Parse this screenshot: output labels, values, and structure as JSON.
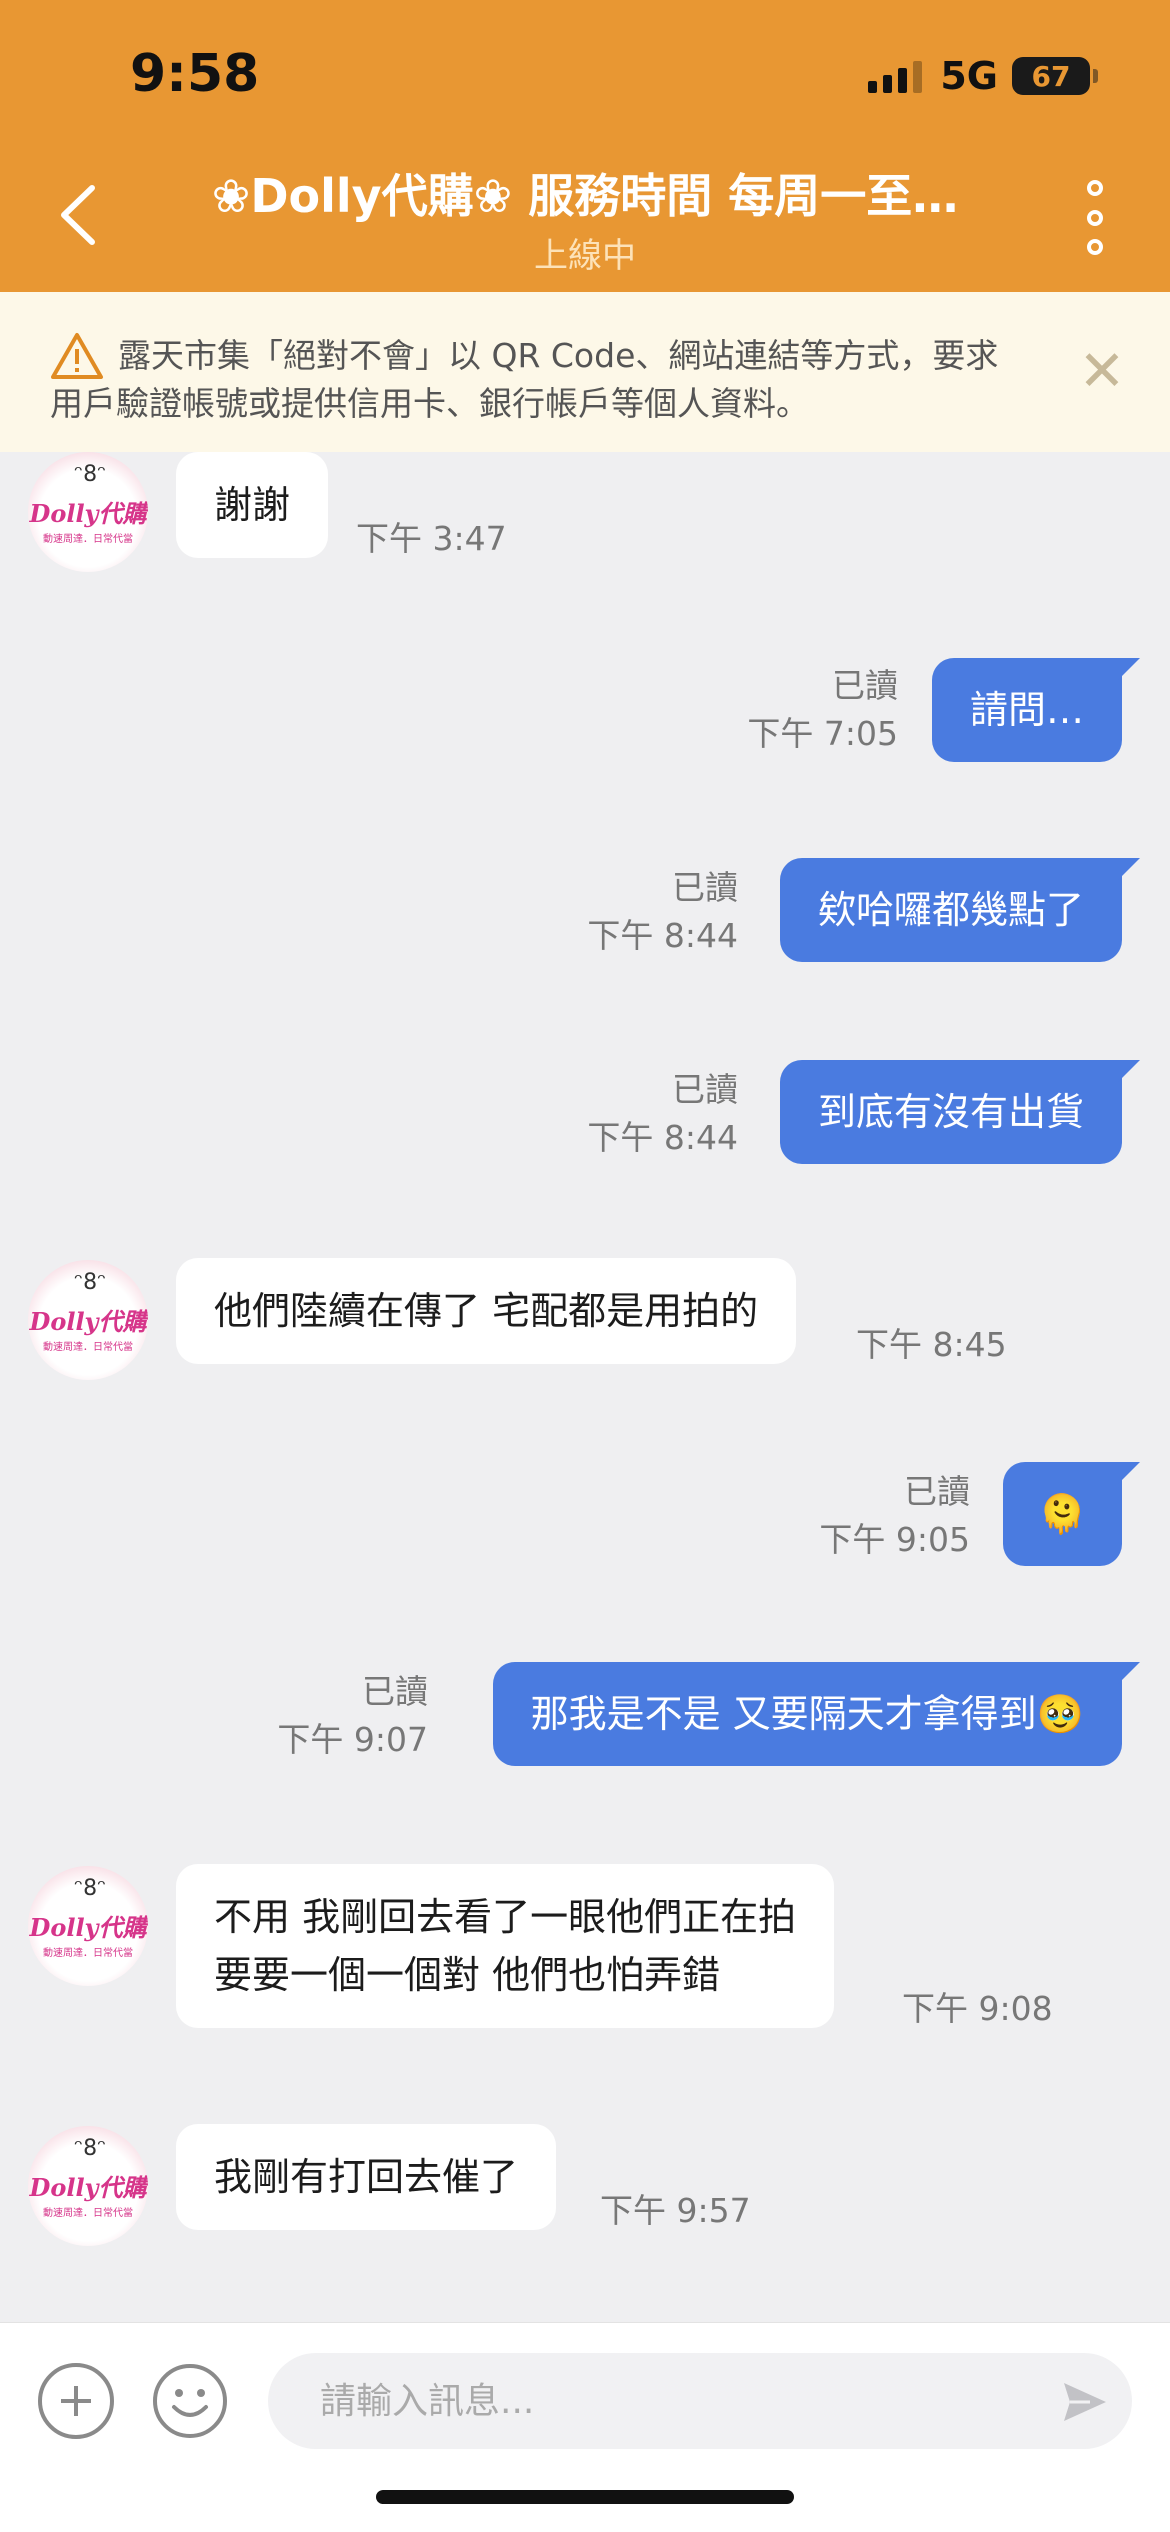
{
  "status_bar": {
    "time": "9:58",
    "network": "5G",
    "battery": "67"
  },
  "header": {
    "title": "❀Dolly代購❀ 服務時間 每周一至…",
    "subtitle": "上線中"
  },
  "warning": {
    "text": "露天市集「絕對不會」以 QR Code、網站連結等方式，要求用戶驗證帳號或提供信用卡、銀行帳戶等個人資料。",
    "close_symbol": "✕"
  },
  "avatar": {
    "logo_text": "Dolly代購",
    "sub_text": "動速周達．日常代當"
  },
  "messages": [
    {
      "side": "in",
      "text": "謝謝",
      "time": "下午 3:47"
    },
    {
      "side": "out",
      "text": "請問…",
      "read": "已讀",
      "time": "下午 7:05"
    },
    {
      "side": "out",
      "text": "欸哈囉都幾點了",
      "read": "已讀",
      "time": "下午 8:44"
    },
    {
      "side": "out",
      "text": "到底有沒有出貨",
      "read": "已讀",
      "time": "下午 8:44"
    },
    {
      "side": "in",
      "text": "他們陸續在傳了 宅配都是用拍的",
      "time": "下午 8:45"
    },
    {
      "side": "out",
      "text": "🫠",
      "read": "已讀",
      "time": "下午 9:05"
    },
    {
      "side": "out",
      "text": "那我是不是 又要隔天才拿得到🥹",
      "read": "已讀",
      "time": "下午 9:07"
    },
    {
      "side": "in",
      "text": "不用 我剛回去看了一眼他們正在拍",
      "text2": "要要一個一個對 他們也怕弄錯",
      "time": "下午 9:08"
    },
    {
      "side": "in",
      "text": "我剛有打回去催了",
      "time": "下午 9:57"
    }
  ],
  "composer": {
    "placeholder": "請輸入訊息..."
  },
  "colors": {
    "header": "#e89733",
    "outgoing_bubble": "#4a7be0",
    "background": "#efeff1"
  }
}
